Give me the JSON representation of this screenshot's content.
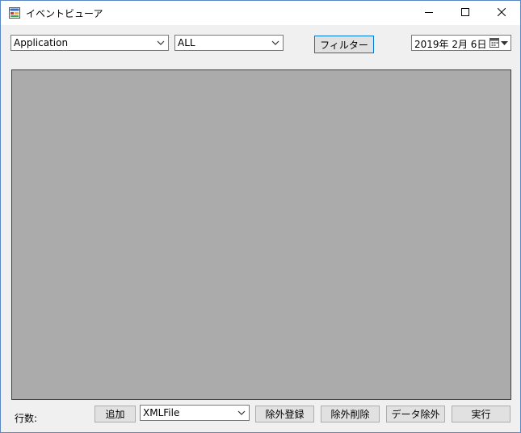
{
  "window": {
    "title": "イベントビューア",
    "caption_buttons": {
      "minimize_icon": "minimize-icon",
      "maximize_icon": "maximize-icon",
      "close_icon": "close-icon"
    }
  },
  "toolbar": {
    "log_select": {
      "value": "Application"
    },
    "level_select": {
      "value": "ALL"
    },
    "filter_label": "フィルター",
    "date_picker": {
      "value": "2019年  2月  6日"
    }
  },
  "grid": {
    "background_color": "#ababab"
  },
  "footer": {
    "rows_label": "行数:",
    "add_label": "追加",
    "file_select": {
      "value": "XMLFile"
    },
    "exclude_register_label": "除外登録",
    "exclude_delete_label": "除外削除",
    "data_exclude_label": "データ除外",
    "run_label": "実行"
  },
  "colors": {
    "window_border": "#5a88c5",
    "focus_border": "#0078d7",
    "button_face": "#e1e1e1",
    "grid_background": "#ababab"
  }
}
